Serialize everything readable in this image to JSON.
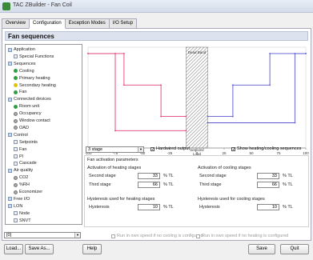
{
  "window": {
    "title": "TAC ZBuilder - Fan Coil"
  },
  "tabs": [
    {
      "label": "Overview"
    },
    {
      "label": "Configuration"
    },
    {
      "label": "Exception Modes"
    },
    {
      "label": "I/O Setup"
    }
  ],
  "panel": {
    "title": "Fan sequences"
  },
  "tree": [
    {
      "label": "Application",
      "icon": "folder-icon",
      "color": "#c9d6e9"
    },
    {
      "label": "Special Functions",
      "icon": "leaf-icon"
    },
    {
      "label": "Sequences",
      "icon": "folder-icon"
    },
    {
      "label": "Cooling",
      "icon": "green-dot-icon",
      "color": "#2ea043"
    },
    {
      "label": "Primary heating",
      "icon": "green-dot-icon",
      "color": "#2ea043"
    },
    {
      "label": "Secondary heating",
      "icon": "yellow-dot-icon",
      "color": "#e2c200"
    },
    {
      "label": "Fan",
      "icon": "green-dot-icon",
      "color": "#2ea043"
    },
    {
      "label": "Connected devices",
      "icon": "folder-icon"
    },
    {
      "label": "Room unit",
      "icon": "green-dot-icon"
    },
    {
      "label": "Occupancy",
      "icon": "gray-dot-icon"
    },
    {
      "label": "Window contact",
      "icon": "gray-dot-icon"
    },
    {
      "label": "OAD",
      "icon": "gray-dot-icon"
    },
    {
      "label": "Control",
      "icon": "folder-icon"
    },
    {
      "label": "Setpoints",
      "icon": "leaf-icon"
    },
    {
      "label": "Fan",
      "icon": "leaf-icon"
    },
    {
      "label": "PI",
      "icon": "leaf-icon"
    },
    {
      "label": "Cascade",
      "icon": "leaf-icon"
    },
    {
      "label": "Air quality",
      "icon": "folder-icon"
    },
    {
      "label": "CO2",
      "icon": "gray-dot-icon"
    },
    {
      "label": "%RH",
      "icon": "gray-dot-icon"
    },
    {
      "label": "Economizer",
      "icon": "gray-dot-icon"
    },
    {
      "label": "Free I/O",
      "icon": "folder-icon"
    },
    {
      "label": "LON",
      "icon": "folder-icon"
    },
    {
      "label": "Node",
      "icon": "leaf-icon"
    },
    {
      "label": "SNVT",
      "icon": "leaf-icon"
    }
  ],
  "chart": {
    "dead_band_label": "Dead Band",
    "setpoint_label": "Setpoint/\nLoad",
    "x_ticks": [
      "-100",
      "-75",
      "-50",
      "-25",
      "0",
      "25",
      "50",
      "75",
      "100"
    ],
    "colors": {
      "heating": "#e0407a",
      "cooling": "#5a5ad0",
      "axis": "#888888"
    }
  },
  "chart_data": {
    "type": "line",
    "x_range": [
      -100,
      100
    ],
    "x_ticks": [
      -100,
      -75,
      -50,
      -25,
      0,
      25,
      50,
      75,
      100
    ],
    "series": [
      {
        "x": [
          -100,
          -67,
          -67,
          -33,
          -33,
          -10
        ],
        "y": [
          3,
          3,
          2,
          2,
          1,
          1
        ]
      },
      {
        "x": [
          -100,
          -75,
          -75,
          -10
        ],
        "y": [
          3,
          3,
          0.55,
          0.55
        ]
      },
      {
        "x": [
          10,
          33,
          33,
          67,
          67,
          100
        ],
        "y": [
          1,
          1,
          2,
          2,
          3,
          3
        ]
      },
      {
        "x": [
          10,
          90,
          90,
          100
        ],
        "y": [
          0.8,
          0.8,
          3,
          3
        ]
      }
    ],
    "dead_band": [
      -10,
      10
    ]
  },
  "controls": {
    "stage_select": "3 stage",
    "hardwired_output": {
      "label": "Hardwired output",
      "checked": true
    },
    "show_sequences": {
      "label": "Show heating/cooling sequences",
      "checked": true
    }
  },
  "params": {
    "title": "Fan activation parameters",
    "heating": {
      "title": "Activation of heating stages",
      "second_label": "Second stage",
      "second_value": "33",
      "second_unit": "% TL",
      "third_label": "Third stage",
      "third_value": "66",
      "third_unit": "% TL"
    },
    "cooling": {
      "title": "Activation of cooling stages",
      "second_label": "Second stage",
      "second_value": "33",
      "second_unit": "% TL",
      "third_label": "Third stage",
      "third_value": "66",
      "third_unit": "% TL"
    },
    "hyst_heating": {
      "title": "Hysteresis used for heating stages",
      "label": "Hysteresis",
      "value": "10",
      "unit": "% TL"
    },
    "hyst_cooling": {
      "title": "Hysteresis used for cooling stages",
      "label": "Hysteresis",
      "value": "10",
      "unit": "% TL"
    }
  },
  "bottom": {
    "combo": "[0]",
    "run_heating": "Run in own speed if no cooling is configured",
    "run_cooling": "Run in own speed if no heating is configured"
  },
  "buttons": {
    "load": "Load...",
    "save_as": "Save As...",
    "help": "Help",
    "save": "Save",
    "quit": "Quit"
  }
}
